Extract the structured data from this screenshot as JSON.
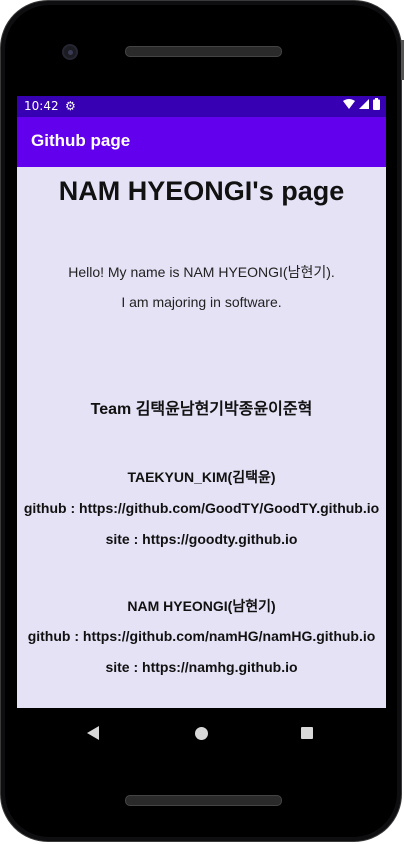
{
  "status_bar": {
    "time": "10:42",
    "settings_icon": "gear-icon",
    "wifi_icon": "wifi-icon",
    "signal_icon": "cell-signal-icon",
    "battery_icon": "battery-icon"
  },
  "app_bar": {
    "title": "Github page",
    "color": "#6200ee"
  },
  "content": {
    "heading": "NAM HYEONGI's page",
    "intro_1": "Hello! My name is NAM HYEONGI(남현기).",
    "intro_2": "I am majoring in software.",
    "team": "Team 김택윤남현기박종윤이준혁",
    "members": [
      {
        "name": "TAEKYUN_KIM(김택윤)",
        "github": "github : https://github.com/GoodTY/GoodTY.github.io",
        "site": "site : https://goodty.github.io"
      },
      {
        "name": "NAM HYEONGI(남현기)",
        "github": "github : https://github.com/namHG/namHG.github.io",
        "site": "site : https://namhg.github.io"
      }
    ]
  },
  "nav_bar": {
    "back_icon": "back-triangle-icon",
    "home_icon": "home-circle-icon",
    "recents_icon": "recents-square-icon"
  }
}
